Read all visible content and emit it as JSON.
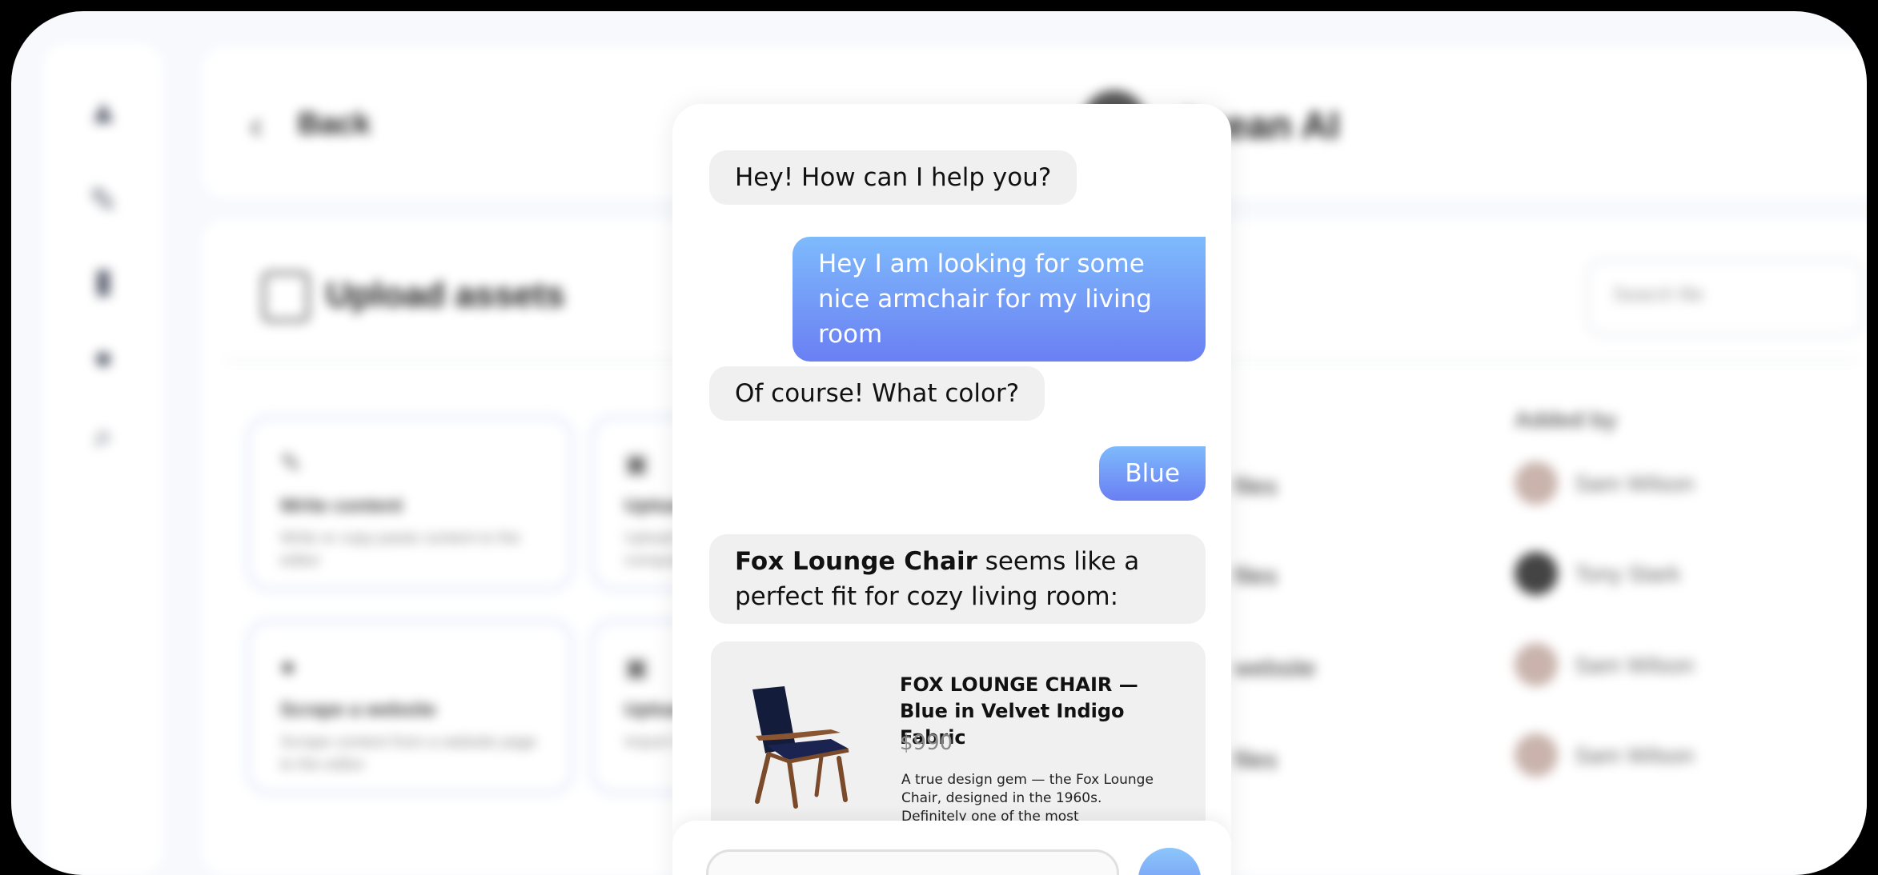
{
  "app": {
    "back_label": "Back",
    "ai_title": "Ocean AI"
  },
  "panel": {
    "title": "Upload assets",
    "search_placeholder": "Search file",
    "cards": [
      {
        "icon": "pencil-icon",
        "title": "Write content",
        "desc": "Write or copy-paste content to the editor"
      },
      {
        "icon": "upload-icon",
        "title": "Upload files",
        "desc": "Upload documents from your computer"
      },
      {
        "icon": "globe-icon",
        "title": "Scrape a website",
        "desc": "Scrape content from a website page to the editor"
      },
      {
        "icon": "link-icon",
        "title": "Upload URL",
        "desc": "Import from a link"
      }
    ],
    "column_header": "Added by",
    "rows_left": [
      "files",
      "files",
      "website",
      "files"
    ],
    "people": [
      "Sam Wilson",
      "Tony Stark",
      "Sam Wilson",
      "Sam Wilson"
    ]
  },
  "chat": {
    "messages": [
      {
        "role": "bot",
        "text": "Hey! How can I help you?"
      },
      {
        "role": "user",
        "text": "Hey I am looking for some nice armchair for my living room"
      },
      {
        "role": "bot",
        "text": "Of course! What color?"
      },
      {
        "role": "user",
        "text": "Blue"
      },
      {
        "role": "bot",
        "bold": "Fox Lounge Chair",
        "text": " seems like a perfect fit for cozy living room:"
      }
    ],
    "product": {
      "name": "FOX LOUNGE CHAIR — Blue in Velvet Indigo Fabric",
      "price": "$990",
      "description": "A true design gem — the Fox Lounge Chair, designed in the 1960s. Definitely one of the most comfortable and"
    }
  },
  "colors": {
    "user_bubble_top": "#7ebafc",
    "user_bubble_bottom": "#6a7ff3",
    "bot_bubble": "#f0f0f0",
    "chair_fabric": "#141c3c",
    "chair_wood": "#7a4a2a"
  }
}
